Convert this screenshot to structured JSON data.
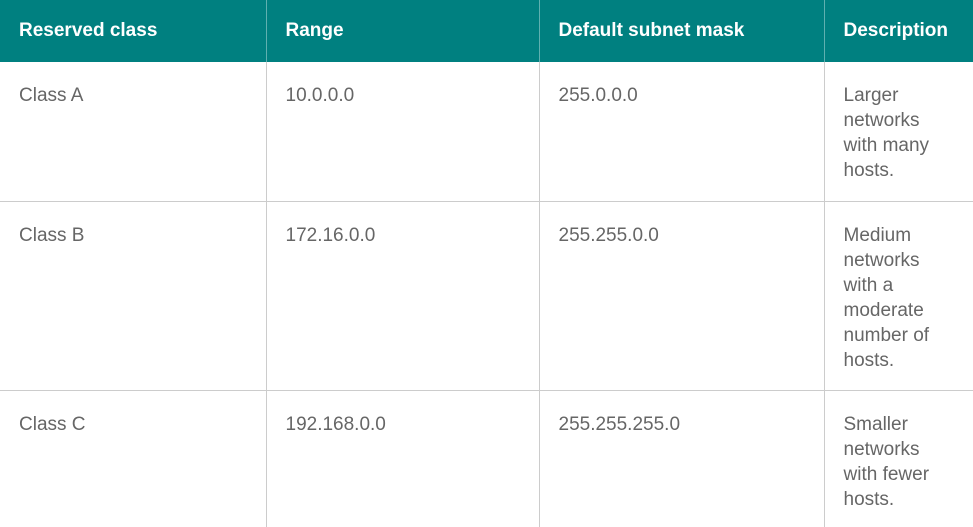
{
  "table": {
    "headers": [
      "Reserved class",
      "Range",
      "Default subnet mask",
      "Description"
    ],
    "rows": [
      [
        "Class A",
        "10.0.0.0",
        "255.0.0.0",
        "Larger networks with many hosts."
      ],
      [
        "Class B",
        "172.16.0.0",
        "255.255.0.0",
        "Medium networks with a moderate number of hosts."
      ],
      [
        "Class C",
        "192.168.0.0",
        "255.255.255.0",
        "Smaller networks with fewer hosts."
      ]
    ]
  },
  "colors": {
    "header_background": "#008080",
    "header_text": "#ffffff",
    "cell_text": "#666666",
    "border": "#cccccc"
  }
}
